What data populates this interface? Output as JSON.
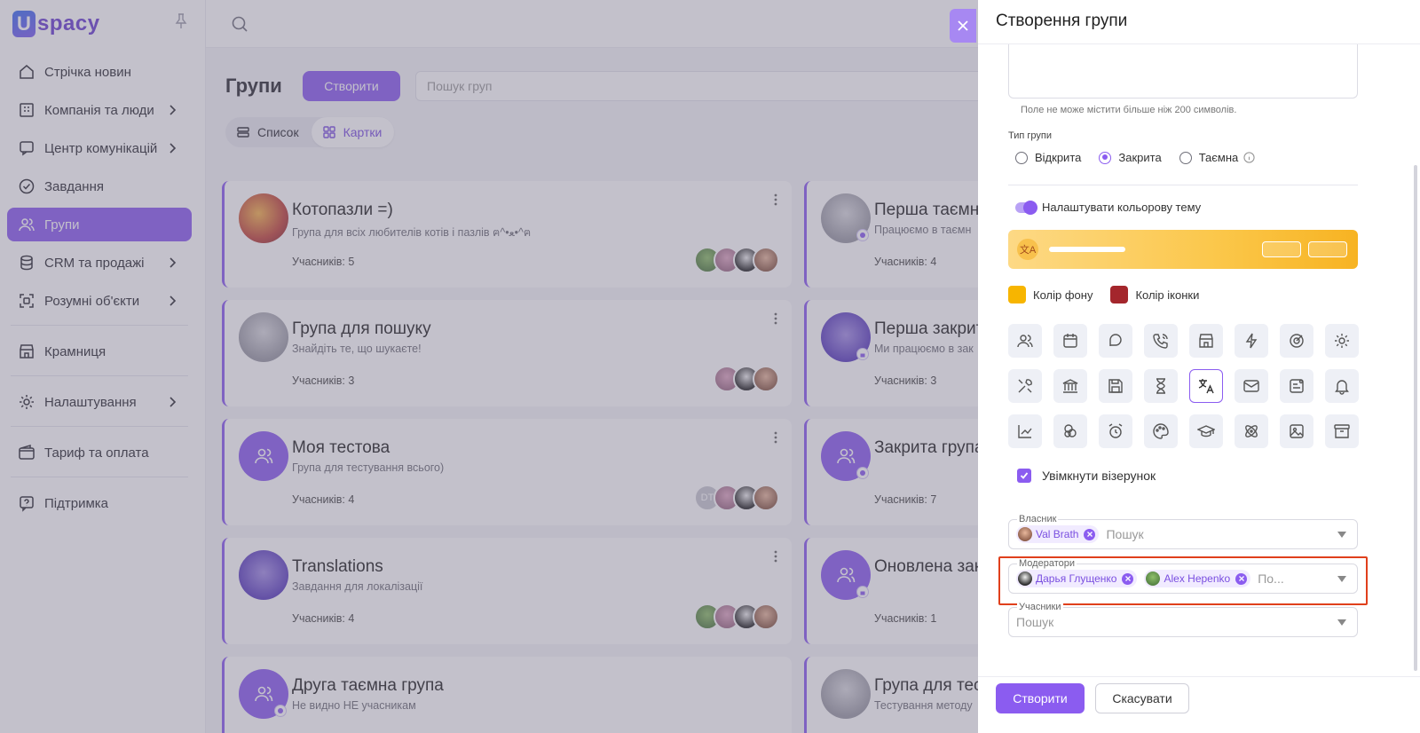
{
  "app": {
    "logo_letter": "U",
    "logo_text": "spacy"
  },
  "sidebar": {
    "items": [
      {
        "label": "Стрічка новин"
      },
      {
        "label": "Компанія та люди"
      },
      {
        "label": "Центр комунікацій"
      },
      {
        "label": "Завдання"
      },
      {
        "label": "Групи"
      },
      {
        "label": "CRM та продажі"
      },
      {
        "label": "Розумні об'єкти"
      },
      {
        "label": "Крамниця"
      },
      {
        "label": "Налаштування"
      },
      {
        "label": "Тариф та оплата"
      },
      {
        "label": "Підтримка"
      }
    ]
  },
  "groups_page": {
    "title": "Групи",
    "create_label": "Створити",
    "search_placeholder": "Пошук груп",
    "view_list": "Список",
    "view_cards": "Картки",
    "cards": [
      {
        "title": "Котопазли =)",
        "desc": "Група для всіх любителів котів і пазлів ฅ^•ﻌ•^ฅ",
        "members": "Учасників: 5"
      },
      {
        "title": "Перша таємна",
        "desc": "Працюємо в таємн",
        "members": "Учасників: 4"
      },
      {
        "title": "Група для пошуку",
        "desc": "Знайдіть те, що шукаєте!",
        "members": "Учасників: 3"
      },
      {
        "title": "Перша закрита",
        "desc": "Ми працюємо в зак",
        "members": "Учасників: 3"
      },
      {
        "title": "Моя тестова",
        "desc": "Група для тестування всього)",
        "members": "Учасників: 4",
        "extra_avatar": "DT"
      },
      {
        "title": "Закрита група",
        "desc": "",
        "members": "Учасників: 7"
      },
      {
        "title": "Translations",
        "desc": "Завдання для локалізації",
        "members": "Учасників: 4"
      },
      {
        "title": "Оновлена зак",
        "desc": "",
        "members": "Учасників: 1"
      },
      {
        "title": "Друга таємна група",
        "desc": "Не видно НЕ учасникам",
        "members": ""
      },
      {
        "title": "Група для тес",
        "desc": "Тестування методу",
        "members": ""
      }
    ]
  },
  "drawer": {
    "title": "Створення групи",
    "description_hint": "Поле не може містити більше ніж 200 символів.",
    "type_label": "Тип групи",
    "type_options": [
      "Відкрита",
      "Закрита",
      "Таємна"
    ],
    "type_selected": "Закрита",
    "color_theme_label": "Налаштувати кольорову тему",
    "color_theme_enabled": true,
    "theme_preview_icon": "文A",
    "bg_color_label": "Колір фону",
    "bg_color": "#F7B500",
    "icon_color_label": "Колір іконки",
    "icon_color": "#A4262C",
    "icon_options": [
      "users-icon",
      "calendar-icon",
      "chat-icon",
      "phone-icon",
      "store-icon",
      "flash-icon",
      "target-icon",
      "gear-icon",
      "tools-icon",
      "bank-icon",
      "save-icon",
      "hourglass-icon",
      "translate-icon",
      "mail-icon",
      "note-icon",
      "bell-icon",
      "chart-icon",
      "clouds-icon",
      "alarm-icon",
      "palette-icon",
      "graduation-icon",
      "atom-icon",
      "image-icon",
      "archive-icon"
    ],
    "selected_icon": "translate-icon",
    "pattern_label": "Увімкнути візерунок",
    "pattern_enabled": true,
    "owner": {
      "label": "Власник",
      "chips": [
        "Val Brath"
      ],
      "placeholder": "Пошук"
    },
    "moderators": {
      "label": "Модератори",
      "chips": [
        "Дарья Глущенко",
        "Alex Hepenko"
      ],
      "placeholder": "По..."
    },
    "participants": {
      "label": "Учасники",
      "placeholder": "Пошук"
    },
    "submit_label": "Створити",
    "cancel_label": "Скасувати"
  },
  "colors": {
    "accent": "#8B5CF0",
    "highlight": "#E0401C"
  }
}
